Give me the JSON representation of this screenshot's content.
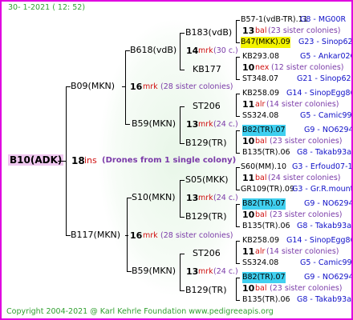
{
  "header": {
    "date": "30-  1-2021  ( 12: 52)"
  },
  "footer": {
    "copyright": "Copyright 2004-2021 @ Karl Kehrle Foundation   www.pedigreeapis.org"
  },
  "root": {
    "name": "B10(ADK)",
    "score": "18",
    "unit": "ins",
    "note": "(Drones from 1 single colony)"
  },
  "gen1": [
    {
      "name": "B09(MKN)",
      "score": "16",
      "unit": "mrk",
      "note": "(28 sister colonies)"
    },
    {
      "name": "B117(MKN)",
      "score": "16",
      "unit": "mrk",
      "note": "(28 sister colonies)"
    }
  ],
  "gen2": [
    {
      "name": "B618(vdB)",
      "score": "14",
      "unit": "mrk",
      "note": "(30 c.)"
    },
    {
      "name": "B59(MKN)",
      "score": "13",
      "unit": "mrk",
      "note": "(24 c.)"
    },
    {
      "name": "S10(MKN)",
      "score": "13",
      "unit": "mrk",
      "note": "(24 c.)"
    },
    {
      "name": "B59(MKN)",
      "score": "13",
      "unit": "mrk",
      "note": "(24 c.)"
    }
  ],
  "gen3": [
    {
      "name": "B183(vdB)"
    },
    {
      "name": "KB177"
    },
    {
      "name": "ST206"
    },
    {
      "name": "B129(TR)"
    },
    {
      "name": "S05(MKK)"
    },
    {
      "name": "B129(TR)"
    },
    {
      "name": "ST206"
    },
    {
      "name": "B129(TR)"
    }
  ],
  "gen4": [
    {
      "top": "B57-1(vdB-TR).11",
      "top_code": "G8 - MG00R",
      "score": "13",
      "unit": "bal",
      "note": "(23 sister colonies)",
      "bottom": "B47(MKK).09",
      "bottom_code": "G23 - Sinop62R"
    },
    {
      "top": "KB293.08",
      "top_code": "G5 - Ankar02Q",
      "score": "10",
      "unit": "nex",
      "note": "(12 sister colonies)",
      "bottom": "ST348.07",
      "bottom_code": "G21 - Sinop62R"
    },
    {
      "top": "KB258.09",
      "top_code": "G14 - SinopEgg86R",
      "score": "11",
      "unit": "alr",
      "note": "(14 sister colonies)",
      "bottom": "SS324.08",
      "bottom_code": "G5 - Camic99R"
    },
    {
      "top": "B82(TR).07",
      "top_code": "G9 - NO6294R",
      "score": "10",
      "unit": "bal",
      "note": "(23 sister colonies)",
      "bottom": "B135(TR).06",
      "bottom_code": "G8 - Takab93aR"
    },
    {
      "top": "S60(MM).10",
      "top_code": "G3 - Erfoud07-1Q",
      "score": "11",
      "unit": "bal",
      "note": "(24 sister colonies)",
      "bottom": "GR109(TR).09",
      "bottom_code": "G3 - Gr.R.mounta"
    },
    {
      "top": "B82(TR).07",
      "top_code": "G9 - NO6294R",
      "score": "10",
      "unit": "bal",
      "note": "(23 sister colonies)",
      "bottom": "B135(TR).06",
      "bottom_code": "G8 - Takab93aR"
    },
    {
      "top": "KB258.09",
      "top_code": "G14 - SinopEgg86R",
      "score": "11",
      "unit": "alr",
      "note": "(14 sister colonies)",
      "bottom": "SS324.08",
      "bottom_code": "G5 - Camic99R"
    },
    {
      "top": "B82(TR).07",
      "top_code": "G9 - NO6294R",
      "score": "10",
      "unit": "bal",
      "note": "(23 sister colonies)",
      "bottom": "B135(TR).06",
      "bottom_code": "G8 - Takab93aR"
    }
  ]
}
